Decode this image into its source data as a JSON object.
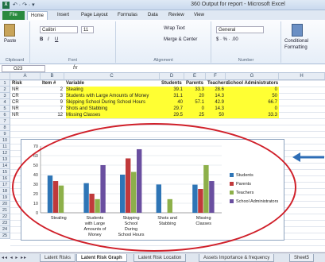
{
  "window": {
    "title": "360 Output for report - Microsoft Excel",
    "app_icon": "excel-icon",
    "quick_access": "↶ · ↷ · ▾"
  },
  "ribbon_tabs": [
    "File",
    "Home",
    "Insert",
    "Page Layout",
    "Formulas",
    "Data",
    "Review",
    "View"
  ],
  "ribbon": {
    "clipboard": {
      "label": "Clipboard",
      "paste": "Paste"
    },
    "font": {
      "label": "Font",
      "name": "Calibri",
      "size": "11",
      "bold": "B",
      "italic": "I",
      "underline": "U"
    },
    "alignment": {
      "label": "Alignment",
      "wrap": "Wrap Text",
      "merge": "Merge & Center"
    },
    "number": {
      "label": "Number",
      "format": "General",
      "symbols": "$ · % ·  .00"
    },
    "styles": {
      "conditional": "Conditional",
      "formatting": "Formatting"
    }
  },
  "formula_bar": {
    "name_box": "O23",
    "fx": "fx",
    "value": ""
  },
  "columns": [
    "A",
    "B",
    "C",
    "D",
    "E",
    "F",
    "G",
    "H"
  ],
  "rows": [
    "1",
    "2",
    "3",
    "4",
    "5",
    "6",
    "7",
    "8",
    "9",
    "10",
    "11",
    "12",
    "13",
    "14",
    "15",
    "16",
    "17",
    "18",
    "19",
    "20",
    "21",
    "22",
    "23",
    "24",
    "25"
  ],
  "table": {
    "headers": [
      "Risk",
      "Item #",
      "Variable",
      "Students",
      "Parents",
      "Teachers",
      "School Administrators"
    ],
    "rows": [
      [
        "NR",
        "2",
        "Stealing",
        "39.1",
        "33.3",
        "28.6",
        "0"
      ],
      [
        "CR",
        "3",
        "Students with Large Amounts of Money",
        "31.1",
        "20",
        "14.3",
        "50"
      ],
      [
        "CR",
        "9",
        "Skipping School During School Hours",
        "40",
        "57.1",
        "42.9",
        "66.7"
      ],
      [
        "NR",
        "7",
        "Shots and Stabbing",
        "29.7",
        "0",
        "14.3",
        "0"
      ],
      [
        "NR",
        "12",
        "Missing Classes",
        "29.5",
        "25",
        "50",
        "33.3"
      ]
    ]
  },
  "chart_data": {
    "type": "bar",
    "categories": [
      "Stealing",
      "Students with Large Amounts of Money",
      "Skipping School During School Hours",
      "Shots and Stabbing",
      "Missing Classes"
    ],
    "series": [
      {
        "name": "Students",
        "values": [
          39.1,
          31.1,
          40,
          29.7,
          29.5
        ],
        "color": "#2e75b6"
      },
      {
        "name": "Parents",
        "values": [
          33.3,
          20,
          57.1,
          0,
          25
        ],
        "color": "#c0393b"
      },
      {
        "name": "Teachers",
        "values": [
          28.6,
          14.3,
          42.9,
          14.3,
          50
        ],
        "color": "#8db04a"
      },
      {
        "name": "School Administrators",
        "values": [
          0,
          50,
          66.7,
          0,
          33.3
        ],
        "color": "#6a4fa0"
      }
    ],
    "ylim": [
      0,
      70
    ],
    "yticks": [
      0,
      10,
      20,
      30,
      40,
      50,
      60,
      70
    ],
    "grid": true,
    "legend": "right",
    "title": "",
    "xlabel": "",
    "ylabel": ""
  },
  "annotations": {
    "ellipse_color": "#d0202a",
    "arrow_color": "#2e6db6"
  },
  "sheet_tabs": [
    "Latent Risks",
    "Latent Risk Graph",
    "Latent Risk Location",
    "Assets Importance & frequency",
    "Sheet5"
  ],
  "active_sheet": "Latent Risk Graph",
  "sheet_nav": "◂◂ ◂ ▸ ▸▸"
}
